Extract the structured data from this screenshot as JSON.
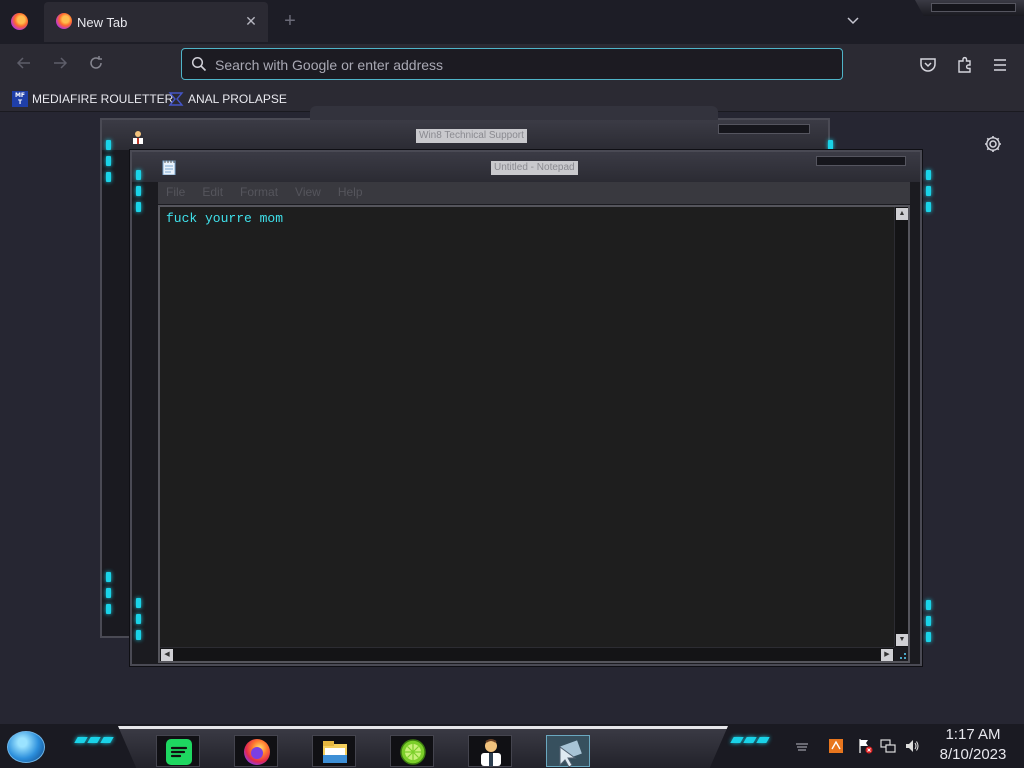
{
  "browser": {
    "tab": {
      "title": "New Tab",
      "close": "✕"
    },
    "new_tab": "+",
    "tab_list": "⌄",
    "urlbar": {
      "placeholder": "Search with Google or enter address",
      "value": ""
    },
    "icons": [
      "firefox-icon",
      "back-icon",
      "forward-icon",
      "reload-icon",
      "search-icon",
      "pocket-icon",
      "extensions-icon",
      "menu-icon",
      "settings-gear-icon"
    ],
    "accent": "#4fb4c8"
  },
  "bookmarks": [
    {
      "label": "MEDIAFIRE ROULETTER",
      "icon_text": "MF T"
    },
    {
      "label": "ANAL PROLAPSE"
    }
  ],
  "windows": {
    "back": {
      "title": "Win8 Technical Support"
    },
    "front": {
      "title": "Untitled - Notepad",
      "menu": [
        "File",
        "Edit",
        "Format",
        "View",
        "Help"
      ],
      "content": "fuck yourre mom",
      "text_color": "#3fe0ea"
    }
  },
  "theme": {
    "glow": "#1ad3e8"
  },
  "taskbar": {
    "apps": [
      "spotify-icon",
      "firefox-icon",
      "file-explorer-icon",
      "limewire-icon",
      "tech-support-icon",
      "cursor-app-icon"
    ],
    "clock": {
      "time": "1:17 AM",
      "date": "8/10/2023"
    }
  }
}
